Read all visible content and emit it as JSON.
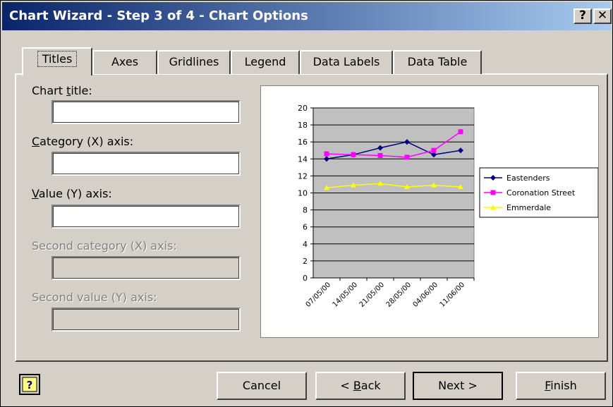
{
  "window": {
    "title": "Chart Wizard - Step 3 of 4 - Chart Options",
    "help_glyph": "?",
    "close_glyph": "✕"
  },
  "tabs": [
    {
      "label": "Titles",
      "active": true
    },
    {
      "label": "Axes"
    },
    {
      "label": "Gridlines"
    },
    {
      "label": "Legend"
    },
    {
      "label": "Data Labels"
    },
    {
      "label": "Data Table"
    }
  ],
  "fields": {
    "chart_title": {
      "label_pre": "Chart ",
      "label_u": "t",
      "label_post": "itle:",
      "value": ""
    },
    "category_x": {
      "label_pre": "",
      "label_u": "C",
      "label_post": "ategory (X) axis:",
      "value": ""
    },
    "value_y": {
      "label_pre": "",
      "label_u": "V",
      "label_post": "alue (Y) axis:",
      "value": ""
    },
    "second_category_x": {
      "label": "Second category (X) axis:",
      "value": ""
    },
    "second_value_y": {
      "label": "Second value (Y) axis:",
      "value": ""
    }
  },
  "buttons": {
    "cancel": "Cancel",
    "back_pre": "< ",
    "back_u": "B",
    "back_post": "ack",
    "next": "Next >",
    "finish_u": "F",
    "finish_post": "inish"
  },
  "chart_data": {
    "type": "line",
    "categories": [
      "07/05/00",
      "14/05/00",
      "21/05/00",
      "28/05/00",
      "04/06/00",
      "11/06/00"
    ],
    "ylim": [
      0,
      20
    ],
    "yticks": [
      0,
      2,
      4,
      6,
      8,
      10,
      12,
      14,
      16,
      18,
      20
    ],
    "grid": true,
    "legend": "right",
    "plot_bg": "#c0c0c0",
    "series": [
      {
        "name": "Eastenders",
        "color": "#000080",
        "marker": "diamond",
        "values": [
          14,
          14.5,
          15.3,
          16,
          14.5,
          15
        ]
      },
      {
        "name": "Coronation Street",
        "color": "#ff00ff",
        "marker": "square",
        "values": [
          14.6,
          14.5,
          14.4,
          14.2,
          15,
          17.2
        ]
      },
      {
        "name": "Emmerdale",
        "color": "#ffff00",
        "marker": "triangle",
        "values": [
          10.6,
          10.9,
          11.1,
          10.7,
          10.9,
          10.7
        ]
      }
    ]
  }
}
